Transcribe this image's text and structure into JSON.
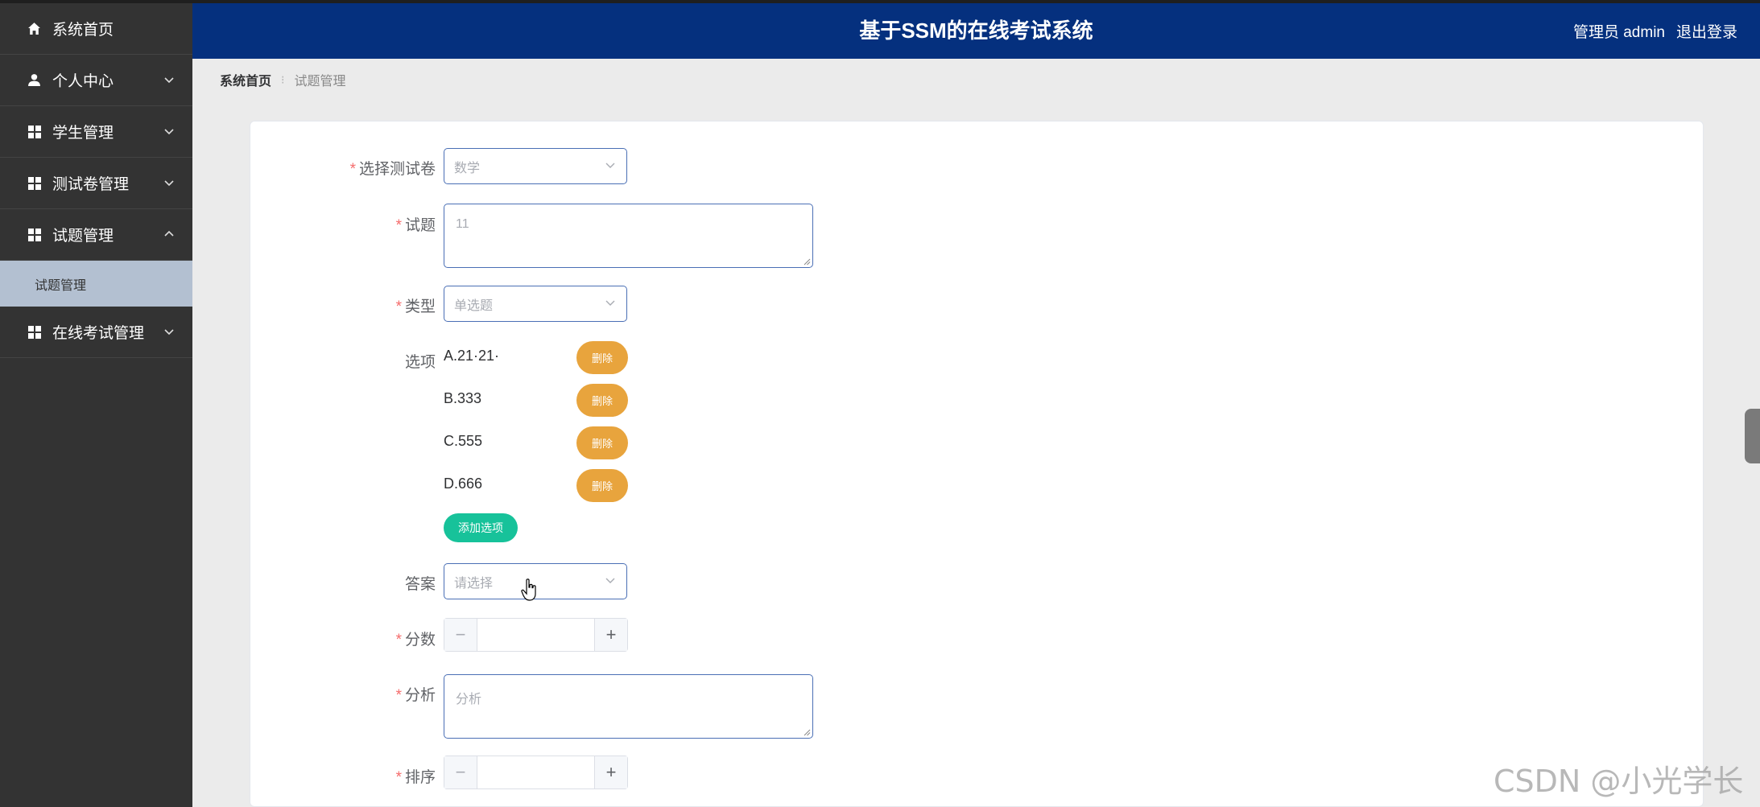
{
  "app": {
    "title": "基于SSM的在线考试系统",
    "user_label": "管理员 admin",
    "logout_label": "退出登录",
    "header_color": "#05307e",
    "sidebar_color": "#333333"
  },
  "sidebar": {
    "items": [
      {
        "label": "系统首页",
        "icon": "home-icon"
      },
      {
        "label": "个人中心",
        "icon": "user-icon"
      },
      {
        "label": "学生管理",
        "icon": "grid-icon"
      },
      {
        "label": "测试卷管理",
        "icon": "grid-icon"
      },
      {
        "label": "试题管理",
        "icon": "grid-icon"
      },
      {
        "label": "在线考试管理",
        "icon": "grid-icon"
      }
    ],
    "sub_items": [
      {
        "label": "试题管理"
      }
    ]
  },
  "breadcrumb": {
    "home": "系统首页",
    "current": "试题管理"
  },
  "form": {
    "paper": {
      "label": "选择测试卷",
      "value": "数学"
    },
    "question": {
      "label": "试题",
      "value": "11"
    },
    "type": {
      "label": "类型",
      "value": "单选题"
    },
    "options": {
      "label": "选项",
      "items": [
        "A.21·21·",
        "B.333",
        "C.555",
        "D.666"
      ],
      "delete_label": "删除",
      "add_label": "添加选项"
    },
    "answer": {
      "label": "答案",
      "placeholder": "请选择"
    },
    "score": {
      "label": "分数",
      "value": ""
    },
    "analysis": {
      "label": "分析",
      "placeholder": "分析"
    },
    "sort": {
      "label": "排序",
      "value": ""
    }
  },
  "colors": {
    "delete_button": "#e8a43d",
    "add_button": "#17c29a",
    "required_mark": "#f56c6c"
  },
  "watermark": "CSDN @小光学长"
}
